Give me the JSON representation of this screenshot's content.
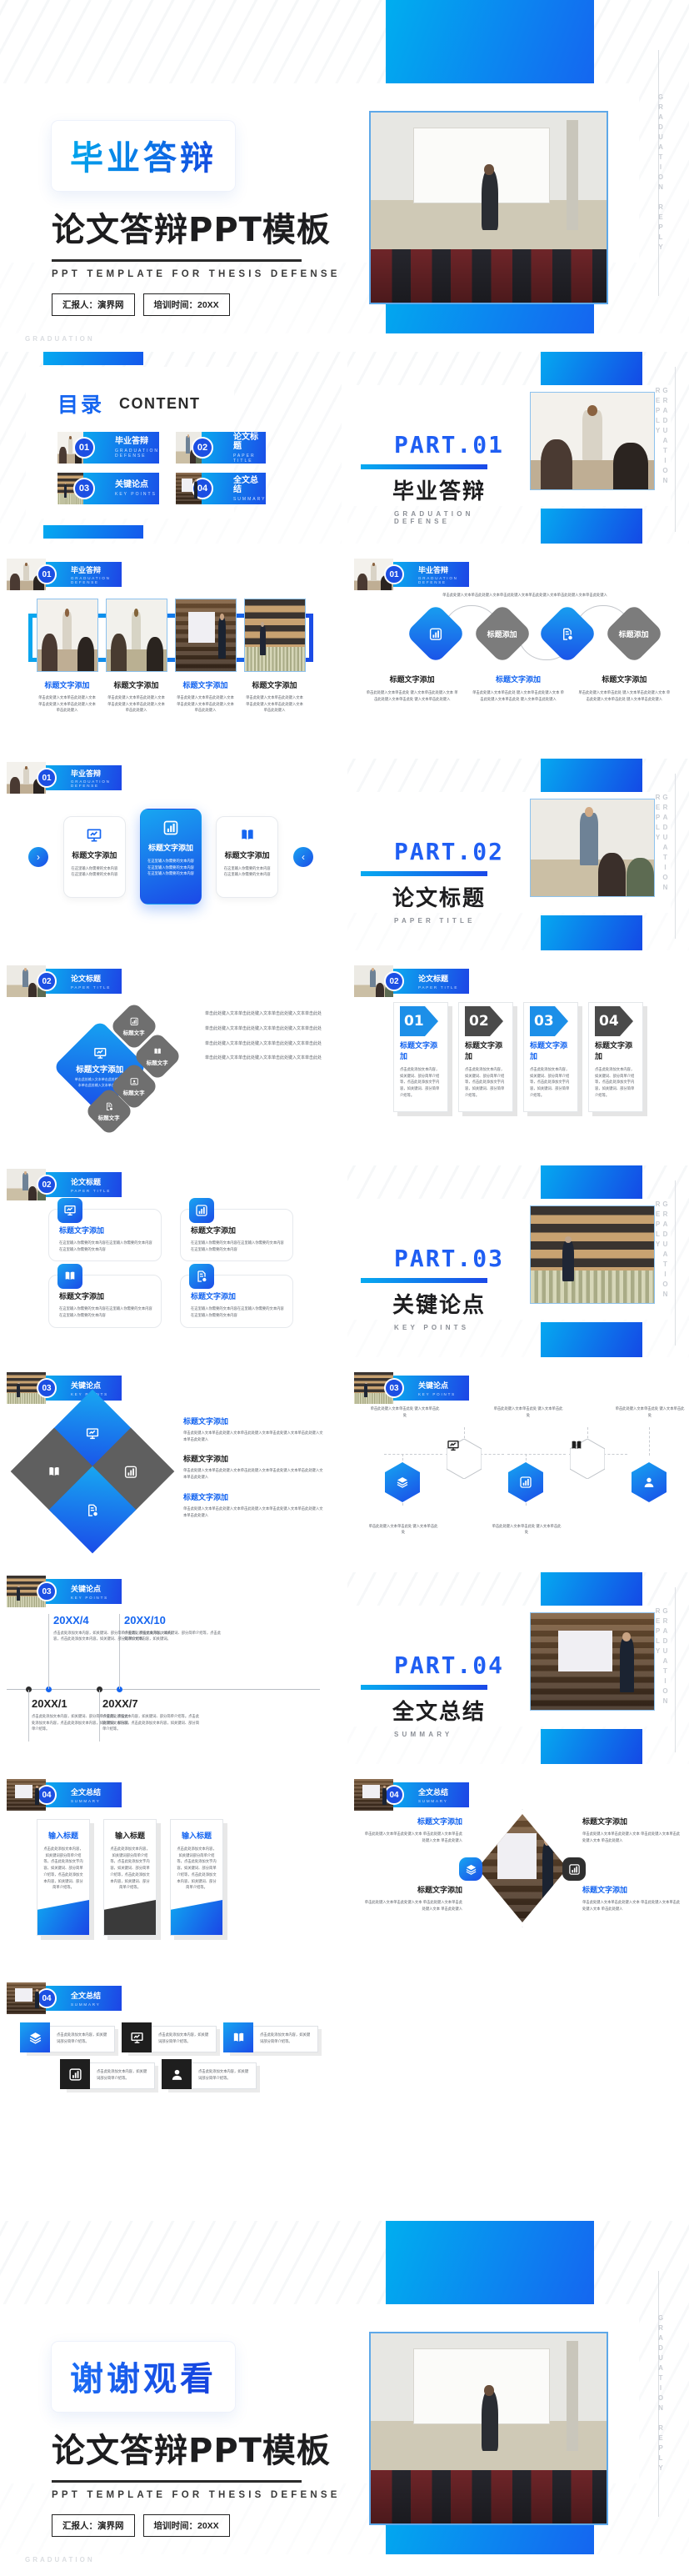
{
  "brand": {
    "accent_blue": "#1565f0",
    "accent_cyan": "#00aeef",
    "gray": "#7c7c7c",
    "dark": "#2f2f2f"
  },
  "cover": {
    "badge_title": "毕业答辩",
    "main_title": "论文答辩PPT模板",
    "english_subtitle": "PPT TEMPLATE FOR THESIS DEFENSE",
    "meta_presenter": "汇报人：演界网",
    "meta_time": "培训时间：20XX",
    "side_vertical": "GRADUATION REPLY",
    "watermark": "GRADUATION"
  },
  "closing": {
    "badge_title": "谢谢观看",
    "main_title": "论文答辩PPT模板",
    "english_subtitle": "PPT TEMPLATE FOR THESIS DEFENSE",
    "meta_presenter": "汇报人：演界网",
    "meta_time": "培训时间：20XX",
    "side_vertical": "GRADUATION REPLY",
    "watermark": "GRADUATION"
  },
  "toc": {
    "title_cn": "目录",
    "title_en": "CONTENT",
    "items": [
      {
        "num": "01",
        "cn": "毕业答辩",
        "en": "GRADUATION DEFENSE"
      },
      {
        "num": "02",
        "cn": "论文标题",
        "en": "PAPER TITLE"
      },
      {
        "num": "03",
        "cn": "关键论点",
        "en": "KEY POINTS"
      },
      {
        "num": "04",
        "cn": "全文总结",
        "en": "SUMMARY"
      }
    ]
  },
  "parts": [
    {
      "no": "PART.01",
      "cn": "毕业答辩",
      "en": "GRADUATION DEFENSE",
      "side": "GRADUATION REPLY"
    },
    {
      "no": "PART.02",
      "cn": "论文标题",
      "en": "PAPER TITLE",
      "side": "GRADUATION REPLY"
    },
    {
      "no": "PART.03",
      "cn": "关键论点",
      "en": "KEY POINTS",
      "side": "GRADUATION REPLY"
    },
    {
      "no": "PART.04",
      "cn": "全文总结",
      "en": "SUMMARY",
      "side": "GRADUATION REPLY"
    }
  ],
  "headers": {
    "h1": {
      "num": "01",
      "cn": "毕业答辩",
      "en": "GRADUATION DEFENSE"
    },
    "h2": {
      "num": "02",
      "cn": "论文标题",
      "en": "PAPER TITLE"
    },
    "h3": {
      "num": "03",
      "cn": "关键论点",
      "en": "KEY POINTS"
    },
    "h4": {
      "num": "04",
      "cn": "全文总结",
      "en": "SUMMARY"
    }
  },
  "common": {
    "title_add": "标题文字添加",
    "title_short": "标题添加",
    "title_tiny": "标题文字",
    "title_input": "输入标题",
    "body_a": "单击此处键入文本单击此处键入文本 单击此处键入文本单击此处键入文本 单击此处键入",
    "body_b": "在这里输入你需要的文本内容在这里输入你需要的文本内容",
    "body_c": "点击此处添加文本内容，如关键词、部分简单介绍等，点击此处添加文本内容，如关键词、部分简单介绍等。",
    "body_d": "单击此处键入文本单击此处键入文本单击此处",
    "body_e": "点击此处添加文本内容，如关键词部分简单介绍等。"
  },
  "slide_s3": {
    "paragraph": "",
    "columns": [
      {
        "title": "标题文字添加",
        "highlight": true,
        "body": "单击此处键入文本单击此处键入文本 单击此处键入文本单击此处键入文本 单击此处键入"
      },
      {
        "title": "标题文字添加",
        "highlight": false,
        "body": "单击此处键入文本单击此处键入文本 单击此处键入文本单击此处键入文本 单击此处键入"
      },
      {
        "title": "标题文字添加",
        "highlight": true,
        "body": "单击此处键入文本单击此处键入文本 单击此处键入文本单击此处键入文本 单击此处键入"
      },
      {
        "title": "标题文字添加",
        "highlight": false,
        "body": "单击此处键入文本单击此处键入文本 单击此处键入文本单击此处键入文本 单击此处键入"
      }
    ]
  },
  "slide_s4": {
    "lead": "单击此处键入文本单击此处键入文本单击此处键入文本单击此处键入文本单击此处键入文本单击此处键入",
    "nodes": [
      {
        "kind": "icon",
        "icon": "bar-chart-icon",
        "color": "blue"
      },
      {
        "kind": "label",
        "label": "标题添加",
        "color": "gray"
      },
      {
        "kind": "icon",
        "icon": "document-icon",
        "color": "blue"
      },
      {
        "kind": "label",
        "label": "标题添加",
        "color": "gray"
      }
    ],
    "columns": [
      {
        "title": "标题文字添加",
        "highlight": false,
        "body": "单击此处键入文本单击此处 键入文本单击此处键入文本 单击此处键入文本单击此处 键入文本单击此处键入"
      },
      {
        "title": "标题文字添加",
        "highlight": true,
        "body": "单击此处键入文本单击此处 键入文本单击此处键入文本 单击此处键入文本单击此处 键入文本单击此处键入"
      },
      {
        "title": "标题文字添加",
        "highlight": false,
        "body": "单击此处键入文本单击此处 键入文本单击此处键入文本 单击此处键入文本单击此处 键入文本单击此处键入"
      }
    ]
  },
  "slide_s5": {
    "cards": [
      {
        "icon": "presentation-icon",
        "title": "标题文字添加",
        "active": false,
        "body": "在这里输入你需要的文本内容在这里输入你需要的文本内容"
      },
      {
        "icon": "bar-chart-icon",
        "title": "标题文字添加",
        "active": true,
        "body": "在这里输入你需要的文本内容在这里输入你需要的文本内容在这里输入你需要的文本内容"
      },
      {
        "icon": "book-icon",
        "title": "标题文字添加",
        "active": false,
        "body": "在这里输入你需要的文本内容在这里输入你需要的文本内容"
      }
    ],
    "nav_next": "›",
    "nav_prev": "‹"
  },
  "slide_s6": {
    "main": {
      "icon": "presentation-icon",
      "title": "标题文字添加",
      "body": "单击此处输入文本单击此处输入文本单击此处输入文本单击此处"
    },
    "small": [
      {
        "icon": "bar-chart-icon",
        "label": "标题文字"
      },
      {
        "icon": "book-icon",
        "label": "标题文字"
      },
      {
        "icon": "user-card-icon",
        "label": "标题文字"
      },
      {
        "icon": "document-icon",
        "label": "标题文字"
      }
    ],
    "list": [
      "单击此处键入文本单击此处键入文本单击此处键入文本单击此处",
      "单击此处键入文本单击此处键入文本单击此处键入文本单击此处",
      "单击此处键入文本单击此处键入文本单击此处键入文本单击此处",
      "单击此处键入文本单击此处键入文本单击此处键入文本单击此处"
    ]
  },
  "slide_s7": {
    "cards": [
      {
        "num": "01",
        "color": "blue",
        "title": "标题文字添加",
        "highlight": true,
        "body": "点击此处添加文本内容，如关键词、部分简单介绍等，点击此处添加文字内容，如关键词、部分简单介绍等。"
      },
      {
        "num": "02",
        "color": "dark",
        "title": "标题文字添加",
        "highlight": false,
        "body": "点击此处添加文本内容，如关键词、部分简单介绍等，点击此处添加文字内容，如关键词、部分简单介绍等。"
      },
      {
        "num": "03",
        "color": "blue",
        "title": "标题文字添加",
        "highlight": true,
        "body": "点击此处添加文本内容，如关键词、部分简单介绍等，点击此处添加文字内容，如关键词、部分简单介绍等。"
      },
      {
        "num": "04",
        "color": "dark",
        "title": "标题文字添加",
        "highlight": false,
        "body": "点击此处添加文本内容，如关键词、部分简单介绍等，点击此处添加文字内容，如关键词、部分简单介绍等。"
      }
    ]
  },
  "slide_s8": {
    "cards": [
      {
        "icon": "presentation-icon",
        "title": "标题文字添加",
        "highlight": true,
        "body": "在这里输入你需要的文本内容在这里输入你需要的文本内容在这里输入你需要的文本内容"
      },
      {
        "icon": "bar-chart-icon",
        "title": "标题文字添加",
        "highlight": false,
        "body": "在这里输入你需要的文本内容在这里输入你需要的文本内容在这里输入你需要的文本内容"
      },
      {
        "icon": "book-icon",
        "title": "标题文字添加",
        "highlight": false,
        "body": "在这里输入你需要的文本内容在这里输入你需要的文本内容在这里输入你需要的文本内容"
      },
      {
        "icon": "document-icon",
        "title": "标题文字添加",
        "highlight": true,
        "body": "在这里输入你需要的文本内容在这里输入你需要的文本内容在这里输入你需要的文本内容"
      }
    ]
  },
  "slide_s9": {
    "diamonds": [
      {
        "icon": "presentation-icon",
        "color": "blue"
      },
      {
        "icon": "book-icon",
        "color": "gray"
      },
      {
        "icon": "bar-chart-icon",
        "color": "gray"
      },
      {
        "icon": "document-icon",
        "color": "blue"
      }
    ],
    "items": [
      {
        "title": "标题文字添加",
        "highlight": true,
        "body": "单击此处键入文本单击此处键入文本单击此处键入文本单击此处键入文本单击此处键入文本单击此处键入"
      },
      {
        "title": "标题文字添加",
        "highlight": false,
        "body": "单击此处键入文本单击此处键入文本单击此处键入文本单击此处键入文本单击此处键入文本单击此处键入"
      },
      {
        "title": "标题文字添加",
        "highlight": true,
        "body": "单击此处键入文本单击此处键入文本单击此处键入文本单击此处键入文本单击此处键入文本单击此处键入"
      }
    ]
  },
  "slide_s10": {
    "nodes": [
      {
        "icon": "layers-icon",
        "style": "blue",
        "pos": "down",
        "text": "单击此处键入文本单击此处 键入文本单击此处"
      },
      {
        "icon": "presentation-icon",
        "style": "outline",
        "pos": "up",
        "text": "单击此处键入文本单击此处 键入文本单击此处"
      },
      {
        "icon": "bar-chart-icon",
        "style": "blue",
        "pos": "down",
        "text": "单击此处键入文本单击此处 键入文本单击此处"
      },
      {
        "icon": "book-icon",
        "style": "outline",
        "pos": "up",
        "text": "单击此处键入文本单击此处 键入文本单击此处"
      },
      {
        "icon": "user-icon",
        "style": "blue",
        "pos": "down",
        "text": "单击此处键入文本单击此处 键入文本单击此处"
      }
    ]
  },
  "slide_s11": {
    "milestones": [
      {
        "year": "20XX/1",
        "position": "below",
        "accent": "dark",
        "body": "点击此处添加文本内容，如关键词、部分简单介绍等。点击此处添加文本内容，点击此处添加文本内容，如关键词、部分简单介绍等。"
      },
      {
        "year": "20XX/4",
        "position": "above",
        "accent": "blue",
        "body": "点击此处添加文本内容，如关键词、部分简单介绍等，点击此处添加文本内容，点击此处添加文本内容，如关键词、部分简单介绍等。"
      },
      {
        "year": "20XX/7",
        "position": "below",
        "accent": "dark",
        "body": "点击此处添加文本内容，如关键词、部分简单介绍等。点击此处添加文本内容，点击此处添加文本内容，如关键词、部分简单介绍等。"
      },
      {
        "year": "20XX/10",
        "position": "above",
        "accent": "blue",
        "body": "点击此处添加文本内容，如关键词、部分简单介绍等，点击此处添加文本内容，如关键词。"
      }
    ]
  },
  "slide_s12": {
    "cards": [
      {
        "title": "输入标题",
        "highlight": true,
        "foot": "blue",
        "body": "点击此处添加文本内容，如关键词部分简单介绍等，点击此处添加文字内容，如关键词、部分简单介绍等，点击此处添加文本内容，如关键词、部分简单介绍等。"
      },
      {
        "title": "输入标题",
        "highlight": false,
        "foot": "dark",
        "body": "点击此处添加文本内容，如关键词部分简单介绍等，点击此处添加文字内容，如关键词、部分简单介绍等，点击此处添加文本内容，如关键词、部分简单介绍等。"
      },
      {
        "title": "输入标题",
        "highlight": true,
        "foot": "blue",
        "body": "点击此处添加文本内容，如关键词部分简单介绍等，点击此处添加文字内容，如关键词、部分简单介绍等，点击此处添加文本内容，如关键词、部分简单介绍等。"
      }
    ]
  },
  "slide_s13": {
    "quadrants": [
      {
        "title": "标题文字添加",
        "highlight": true,
        "align": "right",
        "body": "单击此处键入文本单击此处键入文本 单击此处键入文本单击此处键入文本 单击此处键入"
      },
      {
        "title": "标题文字添加",
        "highlight": false,
        "align": "left",
        "body": "单击此处键入文本单击此处键入文本 单击此处键入文本单击此处键入文本 单击此处键入"
      },
      {
        "title": "标题文字添加",
        "highlight": false,
        "align": "right",
        "body": "单击此处键入文本单击此处键入文本 单击此处键入文本单击此处键入文本 单击此处键入"
      },
      {
        "title": "标题文字添加",
        "highlight": true,
        "align": "left",
        "body": "单击此处键入文本单击此处键入文本 单击此处键入文本单击此处键入文本 单击此处键入"
      }
    ],
    "bubbles": [
      {
        "icon": "layers-icon",
        "color": "blue"
      },
      {
        "icon": "bar-chart-icon",
        "color": "dark"
      }
    ]
  },
  "slide_s14": {
    "rows": [
      [
        {
          "icon": "layers-icon",
          "color": "blue",
          "body": "点击此处添加文本内容，如关键词部分简单介绍等。"
        },
        {
          "icon": "presentation-icon",
          "color": "dark",
          "body": "点击此处添加文本内容，如关键词部分简单介绍等。"
        },
        {
          "icon": "book-icon",
          "color": "blue",
          "body": "点击此处添加文本内容，如关键词部分简单介绍等。"
        }
      ],
      [
        {
          "icon": "bar-chart-icon",
          "color": "dark",
          "body": "点击此处添加文本内容，如关键词部分简单介绍等。"
        },
        {
          "icon": "user-icon",
          "color": "dark",
          "body": "点击此处添加文本内容，如关键词部分简单介绍等。"
        }
      ]
    ]
  }
}
